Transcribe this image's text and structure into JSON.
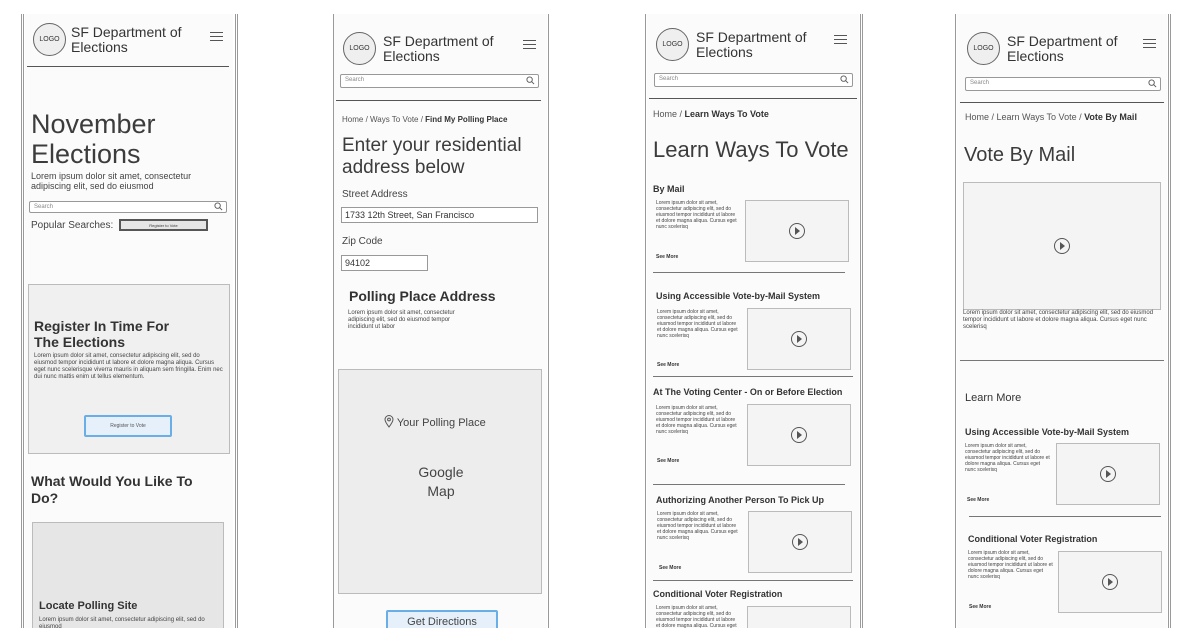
{
  "app": {
    "logo_text": "LOGO",
    "dept_line1": "SF Department of",
    "dept_line2": "Elections",
    "search_placeholder": "Search"
  },
  "screen1": {
    "title_line1": "November",
    "title_line2": "Elections",
    "intro": "Lorem ipsum dolor sit amet, consectetur adipiscing elit, sed do eiusmod",
    "popular_label": "Popular Searches:",
    "popular_chip": "Register to Vote",
    "register_title_line1": "Register In Time For",
    "register_title_line2": "The Elections",
    "register_body": "Lorem ipsum dolor sit amet, consectetur adipiscing elit, sed do eiusmod tempor incididunt ut labore et dolore magna aliqua. Cursus eget nunc scelerisque viverra mauris in aliquam sem fringilla. Enim nec dui nunc mattis enim ut tellus elementum.",
    "register_button": "Register to Vote",
    "what_title_line1": "What Would You Like To",
    "what_title_line2": "Do?",
    "locate_title": "Locate Polling Site",
    "locate_body": "Lorem ipsum dolor sit amet, consectetur adipiscing elit, sed do eiusmod"
  },
  "screen2": {
    "crumb_home": "Home",
    "crumb_mid": "Ways To Vote",
    "crumb_current": "Find My Polling Place",
    "title_line1": "Enter your residential",
    "title_line2": "address below",
    "street_label": "Street Address",
    "street_value": "1733 12th Street, San Francisco",
    "zip_label": "Zip Code",
    "zip_value": "94102",
    "polling_title": "Polling Place Address",
    "polling_body": "Lorem ipsum dolor sit amet, consectetur adipiscing elit, sed do eiusmod tempor incididunt ut labor",
    "map_pin_label": "Your Polling Place",
    "map_line1": "Google",
    "map_line2": "Map",
    "directions_button": "Get Directions"
  },
  "screen3": {
    "crumb_home": "Home",
    "crumb_current": "Learn Ways To Vote",
    "title": "Learn Ways To Vote",
    "see_more": "See More",
    "lorem": "Lorem ipsum dolor sit amet, consectetur adipiscing elit, sed do eiusmod tempor incididunt ut labore et dolore magna aliqua. Cursus eget nunc scelerisq",
    "sections": [
      {
        "title": "By Mail"
      },
      {
        "title": "Using Accessible Vote-by-Mail System"
      },
      {
        "title": "At The Voting Center - On or Before Election"
      },
      {
        "title": "Authorizing Another Person To Pick Up"
      },
      {
        "title": "Conditional Voter Registration"
      }
    ]
  },
  "screen4": {
    "crumb_home": "Home",
    "crumb_mid": "Learn Ways To Vote",
    "crumb_current": "Vote By Mail",
    "title": "Vote By Mail",
    "body": "Lorem ipsum dolor sit amet, consectetur adipiscing elit, sed do eiusmod tempor incididunt ut labore et dolore magna aliqua. Cursus eget nunc scelerisq",
    "learn_more": "Learn More",
    "see_more": "See More",
    "lorem": "Lorem ipsum dolor sit amet, consectetur adipiscing elit, sed do eiusmod tempor incididunt ut labore et dolore magna aliqua. Cursus eget nunc scelerisq",
    "sections": [
      {
        "title": "Using Accessible Vote-by-Mail System"
      },
      {
        "title": "Conditional Voter Registration"
      }
    ]
  }
}
